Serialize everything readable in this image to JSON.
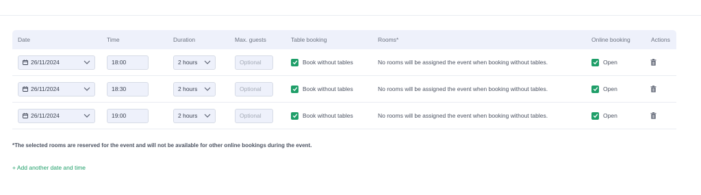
{
  "table": {
    "headers": {
      "date": "Date",
      "time": "Time",
      "duration": "Duration",
      "max_guests": "Max. guests",
      "table_booking": "Table booking",
      "rooms": "Rooms*",
      "online_booking": "Online booking",
      "actions": "Actions"
    },
    "rows": [
      {
        "date": "26/11/2024",
        "time": "18:00",
        "duration": "2 hours",
        "guests_placeholder": "Optional",
        "table_booking_label": "Book without tables",
        "rooms_text": "No rooms will be assigned the event when booking without tables.",
        "online_booking_label": "Open"
      },
      {
        "date": "26/11/2024",
        "time": "18:30",
        "duration": "2 hours",
        "guests_placeholder": "Optional",
        "table_booking_label": "Book without tables",
        "rooms_text": "No rooms will be assigned the event when booking without tables.",
        "online_booking_label": "Open"
      },
      {
        "date": "26/11/2024",
        "time": "19:00",
        "duration": "2 hours",
        "guests_placeholder": "Optional",
        "table_booking_label": "Book without tables",
        "rooms_text": "No rooms will be assigned the event when booking without tables.",
        "online_booking_label": "Open"
      }
    ]
  },
  "footnote": "*The selected rooms are reserved for the event and will not be available for other online bookings during the event.",
  "add_link": "+ Add another date and time",
  "colors": {
    "accent": "#1e9e68",
    "header_bg": "#eef1fb",
    "field_bg": "#eef1fb"
  },
  "icons": {
    "date": "calendar-icon",
    "select": "chevron-down-icon",
    "checkbox": "checkmark-icon",
    "delete": "trash-icon"
  }
}
